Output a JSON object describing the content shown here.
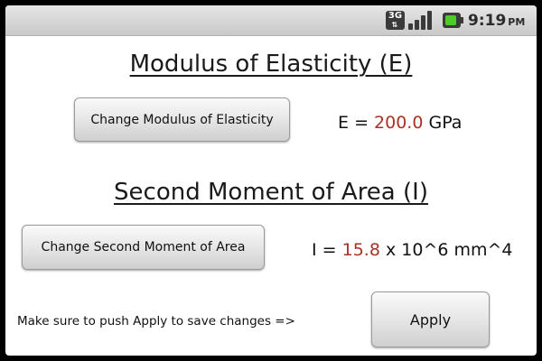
{
  "status_bar": {
    "network_label": "3G",
    "time": "9:19",
    "ampm": "PM"
  },
  "modulus": {
    "title": "Modulus of Elasticity (E)",
    "button_label": "Change Modulus of Elasticity",
    "symbol": "E",
    "equals": "=",
    "value": "200.0",
    "unit": "GPa"
  },
  "moment": {
    "title": "Second Moment of Area (I)",
    "button_label": "Change Second Moment of Area",
    "symbol": "I",
    "equals": "=",
    "value": "15.8",
    "unit": "x 10^6 mm^4"
  },
  "footer": {
    "hint": "Make sure to push Apply to save changes =>",
    "apply_label": "Apply"
  },
  "colors": {
    "value_accent": "#a93226",
    "battery": "#4ecb2a"
  }
}
